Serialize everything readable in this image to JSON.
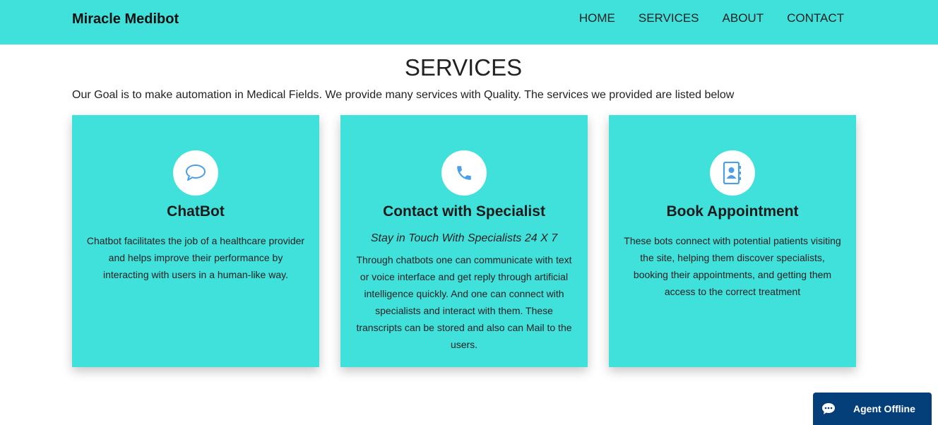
{
  "header": {
    "brand": "Miracle Medibot",
    "nav": [
      "HOME",
      "SERVICES",
      "ABOUT",
      "CONTACT"
    ]
  },
  "section": {
    "title": "SERVICES",
    "intro": "Our Goal is to make automation in Medical Fields. We provide many services with Quality. The services we provided are listed below"
  },
  "cards": [
    {
      "icon": "chat-bubble-icon",
      "title": "ChatBot",
      "text": "Chatbot facilitates the job of a healthcare provider and helps improve their performance by interacting with users in a human-like way."
    },
    {
      "icon": "phone-icon",
      "title": "Contact with Specialist",
      "subtitle": "Stay in Touch With Specialists 24 X 7",
      "text": "Through chatbots one can communicate with text or voice interface and get reply through artificial intelligence quickly. And one can connect with specialists and interact with them. These transcripts can be stored and also can Mail to the users."
    },
    {
      "icon": "contact-book-icon",
      "title": "Book Appointment",
      "text": "These bots connect with potential patients visiting the site, helping them discover specialists, booking their appointments, and getting them access to the correct treatment"
    }
  ],
  "chat_widget": {
    "label": "Agent Offline",
    "icon": "chat-icon"
  },
  "colors": {
    "primary": "#40e0db",
    "icon_blue": "#4a9fe8",
    "widget_bg": "#053f7a"
  }
}
